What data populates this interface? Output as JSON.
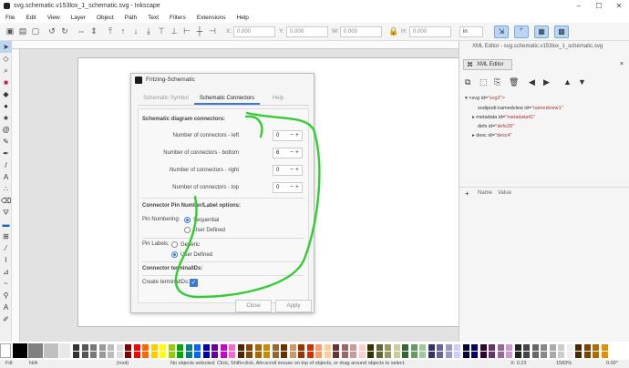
{
  "window": {
    "title": "svg.schematic.v153lox_1_schematic.svg - Inkscape"
  },
  "menu": [
    "File",
    "Edit",
    "View",
    "Layer",
    "Object",
    "Path",
    "Text",
    "Filters",
    "Extensions",
    "Help"
  ],
  "toolbar": {
    "x_label": "X:",
    "x_value": "0.000",
    "y_label": "Y:",
    "y_value": "0.000",
    "w_label": "W:",
    "w_value": "0.000",
    "h_label": "H:",
    "h_value": "0.000",
    "unit": "in"
  },
  "dialog": {
    "title": "Fritzing-Schematic",
    "tabs": [
      "Schematic Symbol",
      "Schematic Connectors",
      "Help"
    ],
    "active_tab": "Schematic Connectors",
    "section_connectors": "Schematic diagram connectors:",
    "rows": [
      {
        "label": "Number of connectors - left",
        "value": "0"
      },
      {
        "label": "Number of connectors - bottom",
        "value": "6"
      },
      {
        "label": "Number of connectors - right",
        "value": "0"
      },
      {
        "label": "Number of connectors - top",
        "value": "0"
      }
    ],
    "section_pin": "Connector Pin Number/Label options:",
    "pin_numbering_label": "Pin Numbering:",
    "pin_numbering_options": [
      "Sequential",
      "User Defined"
    ],
    "pin_numbering_selected": "Sequential",
    "pin_labels_label": "Pin Labels:",
    "pin_labels_options": [
      "Generic",
      "User Defined"
    ],
    "pin_labels_selected": "User Defined",
    "section_terminal": "Connector terminalIDs:",
    "create_terminal_label": "Create terminalIDs:",
    "create_terminal_checked": true,
    "close_label": "Close",
    "apply_label": "Apply"
  },
  "xml_editor": {
    "window_title": "XML Editor - svg.schematic.v153lox_1_schematic.svg",
    "tab_label": "XML Editor",
    "nodes": [
      {
        "text": "<svg id=",
        "val": "\"svg2\">"
      },
      {
        "text": "sodipodi:namedview id=",
        "val": "\"namedview1\""
      },
      {
        "text": "metadata id=",
        "val": "\"metadata41\""
      },
      {
        "text": "defs id=",
        "val": "\"defs39\""
      },
      {
        "text": "desc id=",
        "val": "\"desc4\""
      }
    ],
    "attr_name_header": "Name",
    "attr_value_header": "Value"
  },
  "status": {
    "fill_label": "Fill:",
    "stroke_label": "N/A",
    "layer": "(root)",
    "message": "No objects selected. Click, Shift+click, Alt+scroll mouse on top of objects, or drag around objects to select.",
    "x_coord": "X: 0.23",
    "zoom": "1583%",
    "rotation": "0.00°"
  },
  "colors": {
    "accent": "#3b78d8",
    "annotation_stroke": "#33cc33"
  }
}
